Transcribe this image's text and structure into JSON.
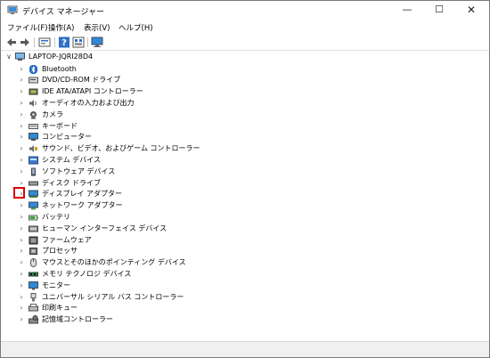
{
  "window": {
    "title": "デバイス マネージャー",
    "controls": {
      "minimize": "—",
      "maximize": "☐",
      "close": "✕"
    }
  },
  "menubar": {
    "items": [
      "ファイル(F)",
      "操作(A)",
      "表示(V)",
      "ヘルプ(H)"
    ]
  },
  "toolbar": {
    "buttons": [
      "back-icon",
      "forward-icon",
      "properties-icon",
      "help-icon",
      "view-icon",
      "monitor-icon"
    ]
  },
  "tree": {
    "root": {
      "label": "LAPTOP-JQRI28D4",
      "expander": "∨"
    },
    "collapsed_glyph": "›",
    "items": [
      {
        "label": "Bluetooth",
        "icon": "bluetooth-icon"
      },
      {
        "label": "DVD/CD-ROM ドライブ",
        "icon": "dvd-drive-icon"
      },
      {
        "label": "IDE ATA/ATAPI コントローラー",
        "icon": "ide-controller-icon"
      },
      {
        "label": "オーディオの入力および出力",
        "icon": "audio-icon"
      },
      {
        "label": "カメラ",
        "icon": "camera-icon"
      },
      {
        "label": "キーボード",
        "icon": "keyboard-icon"
      },
      {
        "label": "コンピューター",
        "icon": "computer-icon"
      },
      {
        "label": "サウンド、ビデオ、およびゲーム コントローラー",
        "icon": "sound-icon"
      },
      {
        "label": "システム デバイス",
        "icon": "system-device-icon"
      },
      {
        "label": "ソフトウェア デバイス",
        "icon": "software-device-icon"
      },
      {
        "label": "ディスク ドライブ",
        "icon": "disk-drive-icon"
      },
      {
        "label": "ディスプレイ アダプター",
        "icon": "display-adapter-icon"
      },
      {
        "label": "ネットワーク アダプター",
        "icon": "network-adapter-icon"
      },
      {
        "label": "バッテリ",
        "icon": "battery-icon"
      },
      {
        "label": "ヒューマン インターフェイス デバイス",
        "icon": "hid-icon"
      },
      {
        "label": "ファームウェア",
        "icon": "firmware-icon"
      },
      {
        "label": "プロセッサ",
        "icon": "processor-icon"
      },
      {
        "label": "マウスとそのほかのポインティング デバイス",
        "icon": "mouse-icon"
      },
      {
        "label": "メモリ テクノロジ デバイス",
        "icon": "memory-icon"
      },
      {
        "label": "モニター",
        "icon": "monitor-icon"
      },
      {
        "label": "ユニバーサル シリアル バス コントローラー",
        "icon": "usb-icon"
      },
      {
        "label": "印刷キュー",
        "icon": "print-queue-icon"
      },
      {
        "label": "記憶域コントローラー",
        "icon": "storage-controller-icon"
      }
    ]
  },
  "colors": {
    "highlight": "#e00000",
    "bluetooth": "#1e63c6",
    "monitor_blue": "#2f8ad8"
  }
}
